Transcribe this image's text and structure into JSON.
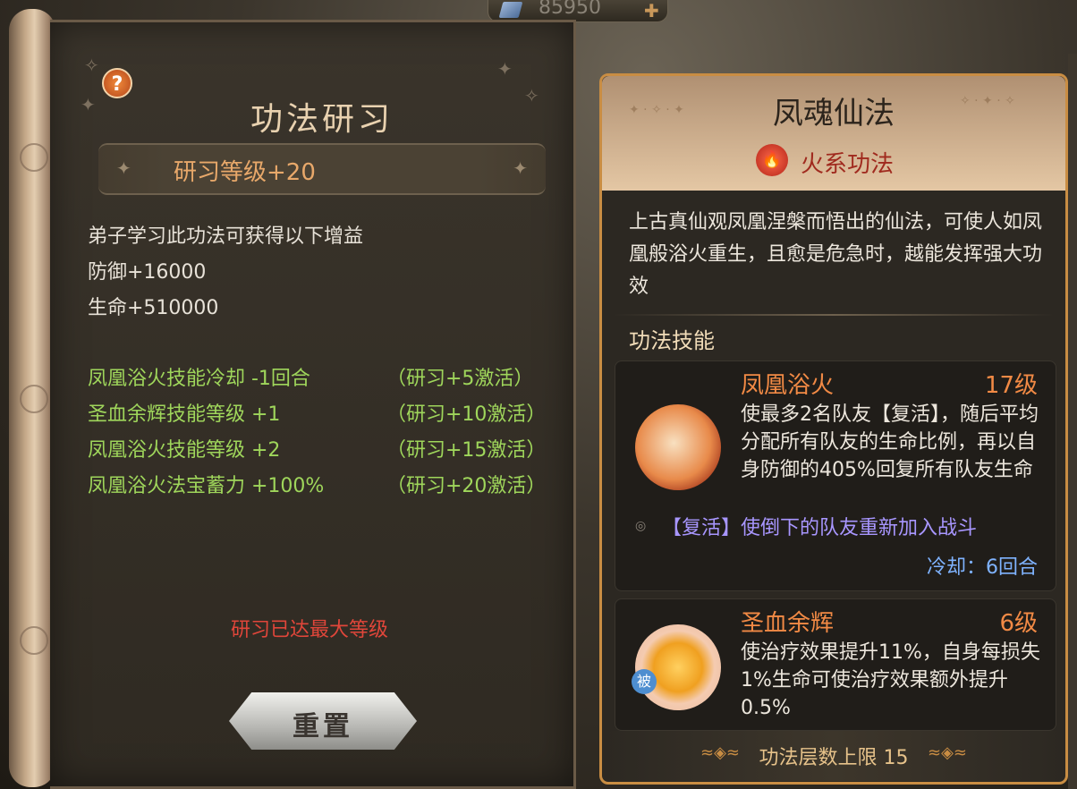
{
  "topbar": {
    "amount": "85950"
  },
  "left": {
    "title": "功法研习",
    "level_banner": "研习等级+20",
    "intro": "弟子学习此功法可获得以下增益",
    "stats": [
      "防御+16000",
      "生命+510000"
    ],
    "bonuses": [
      {
        "effect": "凤凰浴火技能冷却 -1回合",
        "condition": "（研习+5激活）"
      },
      {
        "effect": "圣血余辉技能等级 +1",
        "condition": "（研习+10激活）"
      },
      {
        "effect": "凤凰浴火技能等级 +2",
        "condition": "（研习+15激活）"
      },
      {
        "effect": "凤凰浴火法宝蓄力 +100%",
        "condition": "（研习+20激活）"
      }
    ],
    "max_notice": "研习已达最大等级",
    "reset_label": "重置"
  },
  "right": {
    "title": "凤魂仙法",
    "element_label": "火系功法",
    "description": "上古真仙观凤凰涅槃而悟出的仙法，可使人如凤凰般浴火重生，且愈是危急时，越能发挥强大功效",
    "section_title": "功法技能",
    "skills": [
      {
        "name": "凤凰浴火",
        "level": "17级",
        "desc": "使最多2名队友【复活】，随后平均分配所有队友的生命比例，再以自身防御的405%回复所有队友生命",
        "note": "【复活】使倒下的队友重新加入战斗",
        "cooldown": "冷却：6回合"
      },
      {
        "name": "圣血余辉",
        "level": "6级",
        "desc": "使治疗效果提升11%，自身每损失1%生命可使治疗效果额外提升0.5%",
        "badge": "被"
      }
    ],
    "footer": "功法层数上限 15"
  },
  "colors": {
    "accent": "#c98d43",
    "skill_name": "#f28a45",
    "bonus_green": "#9fd65b",
    "warning": "#e0463a"
  }
}
